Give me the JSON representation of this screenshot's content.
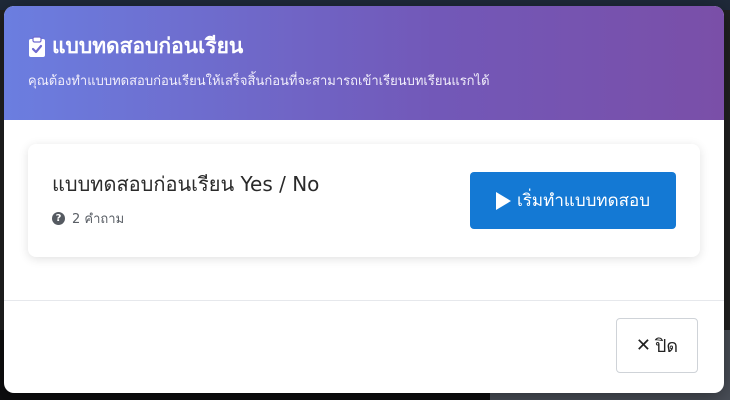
{
  "modal": {
    "title": "แบบทดสอบก่อนเรียน",
    "subtitle": "คุณต้องทำแบบทดสอบก่อนเรียนให้เสร็จสิ้นก่อนที่จะสามารถเข้าเรียนบทเรียนแรกได้",
    "title_icon": "clipboard-check-icon",
    "header_gradient": [
      "#6b7ee0",
      "#7a4fa8"
    ]
  },
  "quiz": {
    "title": "แบบทดสอบก่อนเรียน Yes / No",
    "question_count": "2 คำถาม",
    "meta_icon": "question-circle-icon",
    "start_label": "เริ่มทำแบบทดสอบ",
    "start_icon": "play-icon",
    "start_color": "#1479d4"
  },
  "footer": {
    "close_label": "ปิด",
    "close_icon": "close-icon"
  }
}
